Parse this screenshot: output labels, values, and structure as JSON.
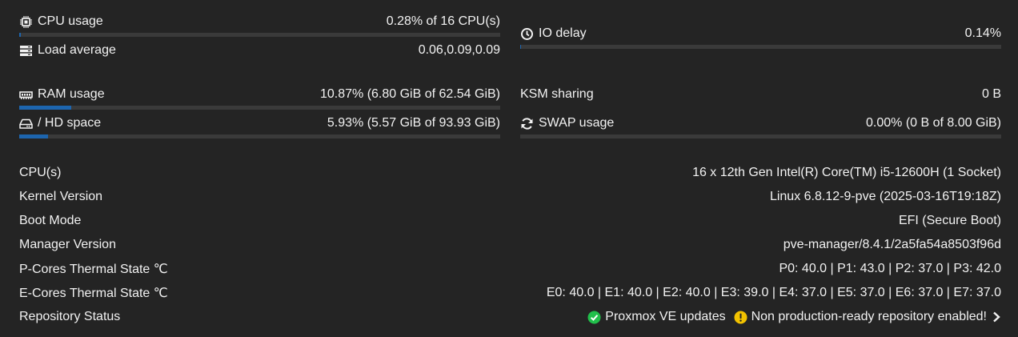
{
  "metrics": {
    "cpu": {
      "label": "CPU usage",
      "value": "0.28% of 16 CPU(s)",
      "fraction": 0.0028
    },
    "load": {
      "label": "Load average",
      "value": "0.06,0.09,0.09"
    },
    "io": {
      "label": "IO delay",
      "value": "0.14%",
      "fraction": 0.0014
    },
    "ram": {
      "label": "RAM usage",
      "value": "10.87% (6.80 GiB of 62.54 GiB)",
      "fraction": 0.1087
    },
    "ksm": {
      "label": "KSM sharing",
      "value": "0 B"
    },
    "hd": {
      "label": "/ HD space",
      "value": "5.93% (5.57 GiB of 93.93 GiB)",
      "fraction": 0.0593
    },
    "swap": {
      "label": "SWAP usage",
      "value": "0.00% (0 B of 8.00 GiB)",
      "fraction": 0.0
    }
  },
  "info": {
    "cpus": {
      "label": "CPU(s)",
      "value": "16 x 12th Gen Intel(R) Core(TM) i5-12600H (1 Socket)"
    },
    "kernel": {
      "label": "Kernel Version",
      "value": "Linux 6.8.12-9-pve (2025-03-16T19:18Z)"
    },
    "boot": {
      "label": "Boot Mode",
      "value": "EFI (Secure Boot)"
    },
    "manager": {
      "label": "Manager Version",
      "value": "pve-manager/8.4.1/2a5fa54a8503f96d"
    },
    "pcores": {
      "label": "P-Cores Thermal State ℃",
      "value": "P0: 40.0 | P1: 43.0 | P2: 37.0 | P3: 42.0"
    },
    "ecores": {
      "label": "E-Cores Thermal State ℃",
      "value": "E0: 40.0 | E1: 40.0 | E2: 40.0 | E3: 39.0 | E4: 37.0 | E5: 37.0 | E6: 37.0 | E7: 37.0"
    },
    "repo": {
      "label": "Repository Status",
      "updates": "Proxmox VE updates",
      "warning": "Non production-ready repository enabled!"
    }
  },
  "colors": {
    "bar_fill": "#1d65ae",
    "bar_track": "#3a3a3a",
    "ok_green": "#21bf4b",
    "warn_yellow": "#f2c200"
  },
  "icons": {
    "cpu": "cpu-chip-icon",
    "load": "server-stack-icon",
    "io": "clock-icon",
    "ram": "memory-module-icon",
    "hd": "hard-drive-icon",
    "swap": "refresh-icon",
    "repo_ok": "check-circle-icon",
    "repo_warn": "exclamation-circle-icon",
    "repo_more": "chevron-right-icon"
  }
}
